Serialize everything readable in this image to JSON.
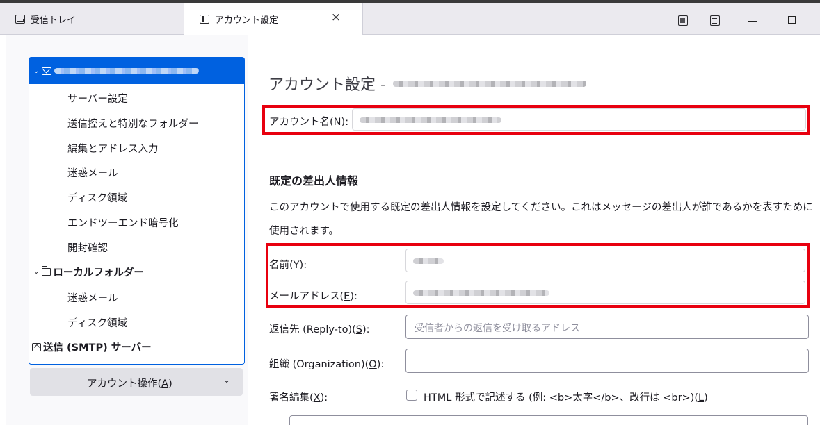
{
  "tabs": [
    {
      "label": "受信トレイ",
      "icon": "inbox-icon"
    },
    {
      "label": "アカウント設定",
      "icon": "settings-tab-icon",
      "close": "×"
    }
  ],
  "window_controls": {
    "minimize": "—",
    "maximize": "□"
  },
  "sidebar": {
    "account_items": [
      "サーバー設定",
      "送信控えと特別なフォルダー",
      "編集とアドレス入力",
      "迷惑メール",
      "ディスク領域",
      "エンドツーエンド暗号化",
      "開封確認"
    ],
    "local_folders": {
      "label": "ローカルフォルダー",
      "items": [
        "迷惑メール",
        "ディスク領域"
      ]
    },
    "smtp": "送信 (SMTP) サーバー",
    "account_actions": {
      "label": "アカウント操作(",
      "key": "A",
      "suffix": ")"
    }
  },
  "main": {
    "title": "アカウント設定 -",
    "account_name": {
      "label": "アカウント名(",
      "key": "N",
      "suffix": "):"
    },
    "identity_heading": "既定の差出人情報",
    "identity_desc": "このアカウントで使用する既定の差出人情報を設定してください。これはメッセージの差出人が誰であるかを表すために使用されます。",
    "name": {
      "label": "名前(",
      "key": "Y",
      "suffix": "):"
    },
    "email": {
      "label": "メールアドレス(",
      "key": "E",
      "suffix": "):"
    },
    "reply_to": {
      "label": "返信先 (Reply-to)(",
      "key": "S",
      "suffix": "):",
      "placeholder": "受信者からの返信を受け取るアドレス"
    },
    "organization": {
      "label": "組織 (Organization)(",
      "key": "O",
      "suffix": "):"
    },
    "signature": {
      "label": "署名編集(",
      "key": "X",
      "suffix": "):",
      "html_checkbox": "HTML 形式で記述する (例: <b>太字</b>、改行は <br>)(",
      "html_key": "L",
      "html_suffix": ")"
    }
  },
  "colors": {
    "accent": "#0061e0",
    "highlight": "#e8000f"
  }
}
